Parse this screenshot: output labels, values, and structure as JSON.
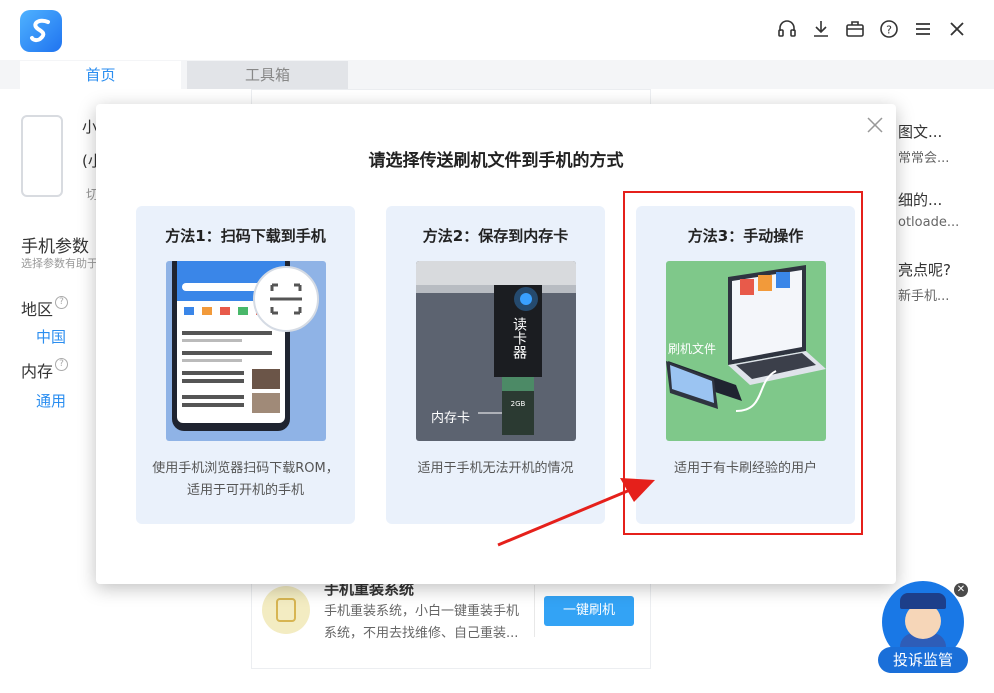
{
  "window": {
    "tabs": [
      {
        "label": "首页",
        "active": true
      },
      {
        "label": "工具箱",
        "active": false
      }
    ],
    "toolbar_icons": [
      "headset-icon",
      "download-icon",
      "briefcase-icon",
      "help-icon",
      "menu-icon",
      "close-icon"
    ]
  },
  "background": {
    "device_name_partial": "小",
    "device_model_partial": "(小",
    "device_switch_partial": "切",
    "params_title": "手机参数",
    "params_subtitle": "选择参数有助于",
    "region_label": "地区",
    "region_value": "中国",
    "memory_label": "内存",
    "memory_value": "通用",
    "rescue_title": "手机重装系统",
    "rescue_desc": "手机重装系统，小白一键重装手机系统，不用去找维修、自己重装...",
    "flash_button": "一键刷机",
    "right_items": [
      {
        "title": "图文...",
        "sub": "常常会..."
      },
      {
        "title": "细的...",
        "sub": "otloade..."
      },
      {
        "title": "亮点呢?",
        "sub": "新手机..."
      }
    ],
    "complaint_label": "投诉监管"
  },
  "dialog": {
    "title": "请选择传送刷机文件到手机的方式",
    "options": [
      {
        "title": "方法1：扫码下载到手机",
        "desc_line1": "使用手机浏览器扫码下载ROM，",
        "desc_line2": "适用于可开机的手机"
      },
      {
        "title": "方法2：保存到内存卡",
        "desc_line1": "适用于手机无法开机的情况",
        "desc_line2": ""
      },
      {
        "title": "方法3：手动操作",
        "desc_line1": "适用于有卡刷经验的用户",
        "desc_line2": ""
      }
    ],
    "img2_reader_label": "读卡器",
    "img2_card_label": "内存卡",
    "img3_file_label": "刷机文件"
  },
  "colors": {
    "accent": "#2b8ef0",
    "option_bg": "#eaf1fb",
    "highlight": "#e5201b",
    "flash_button": "#33a3f5"
  }
}
